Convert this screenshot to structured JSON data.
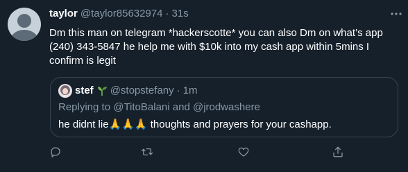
{
  "tweet": {
    "display_name": "taylor",
    "handle": "@taylor85632974",
    "separator": "·",
    "time": "31s",
    "text": "Dm this man on telegram *hackerscotte* you can also Dm on what’s app (240) 343-5847 he help me with $10k into my cash app within 5mins I confirm is legit",
    "more_icon": "more-horizontal-icon"
  },
  "quote": {
    "display_name": "stef",
    "emoji": "🌱",
    "handle": "@stopstefany",
    "separator": "·",
    "time": "1m",
    "replying_prefix": "Replying to",
    "replying_user1": "@TitoBalani",
    "replying_and": "and",
    "replying_user2": "@jrodwashere",
    "text": "he didnt lie🙏🙏🙏 thoughts and prayers for your cashapp."
  },
  "actions": {
    "icons": [
      "reply-icon",
      "retweet-icon",
      "like-icon",
      "share-icon"
    ],
    "icon_color": "#8899a6"
  },
  "colors": {
    "background": "#15202b",
    "text_primary": "#ffffff",
    "text_secondary": "#8899a6",
    "border": "#38444d"
  }
}
